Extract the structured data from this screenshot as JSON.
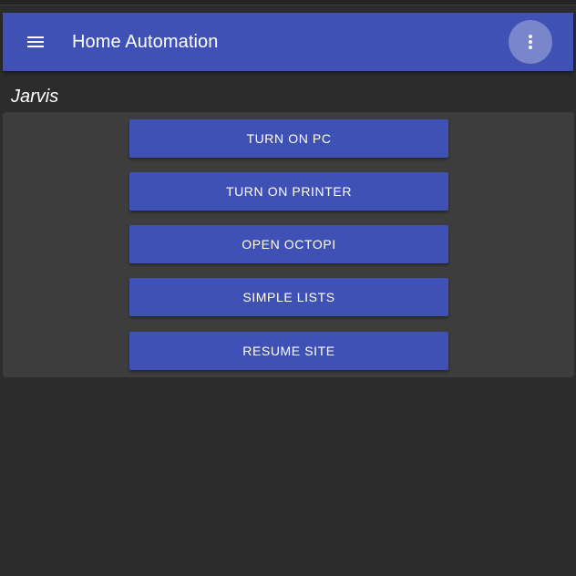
{
  "app_bar": {
    "title": "Home Automation",
    "menu_icon": "hamburger-menu-icon",
    "more_icon": "more-vertical-icon",
    "color": "#3f51b5",
    "more_button_color": "#7a86cc"
  },
  "section": {
    "heading": "Jarvis",
    "buttons": [
      {
        "label": "TURN ON PC"
      },
      {
        "label": "TURN ON PRINTER"
      },
      {
        "label": "OPEN OCTOPI"
      },
      {
        "label": "SIMPLE LISTS"
      },
      {
        "label": "RESUME SITE"
      }
    ]
  },
  "theme": {
    "background": "#2c2c2c",
    "panel": "#3d3d3d",
    "button": "#3f51b5",
    "text": "#ffffff"
  }
}
